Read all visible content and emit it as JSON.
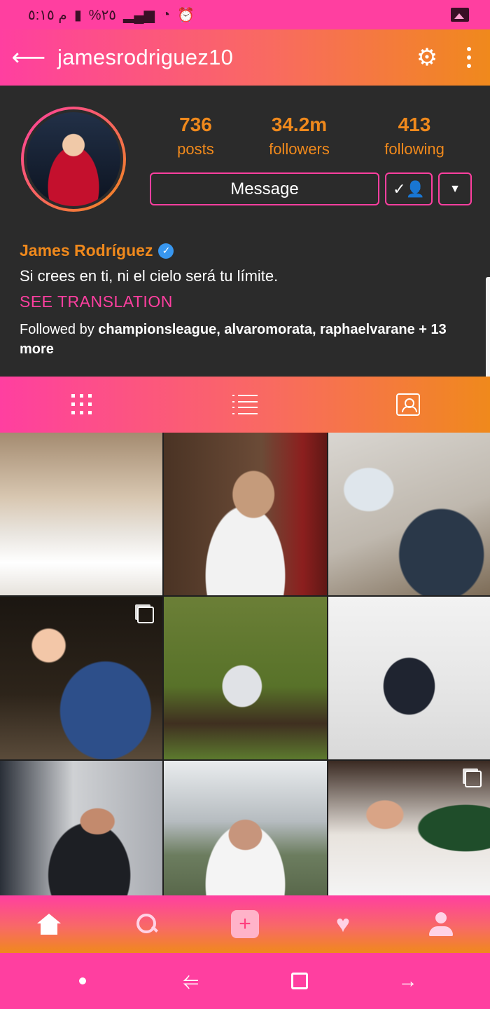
{
  "status_bar": {
    "time": "م ٥:١٥",
    "battery": "%٢٥"
  },
  "header": {
    "username": "jamesrodriguez10",
    "back_icon": "arrow-left-icon",
    "settings_icon": "gears-icon",
    "more_icon": "kebab-menu-icon"
  },
  "profile": {
    "stats": [
      {
        "value": "736",
        "label": "posts"
      },
      {
        "value": "34.2m",
        "label": "followers"
      },
      {
        "value": "413",
        "label": "following"
      }
    ],
    "message_label": "Message",
    "full_name": "James Rodríguez",
    "bio": "Si crees en ti, ni el cielo será tu límite.",
    "see_translation": "SEE TRANSLATION",
    "followed_by_prefix": "Followed by",
    "followed_by_names": "championsleague, alvaromorata, raphaelvarane",
    "followed_by_suffix": "+ 13 more"
  },
  "tabs": [
    {
      "icon": "grid-icon"
    },
    {
      "icon": "list-icon"
    },
    {
      "icon": "tagged-icon"
    }
  ],
  "bottom_nav": [
    {
      "icon": "home-icon"
    },
    {
      "icon": "search-icon"
    },
    {
      "icon": "add-icon",
      "symbol": "+"
    },
    {
      "icon": "heart-icon",
      "symbol": "♥"
    },
    {
      "icon": "profile-icon"
    }
  ],
  "colors": {
    "accent_pink": "#ff3fa0",
    "accent_orange": "#f0891c",
    "background": "#2b2b2b",
    "verified_blue": "#3897f0"
  }
}
